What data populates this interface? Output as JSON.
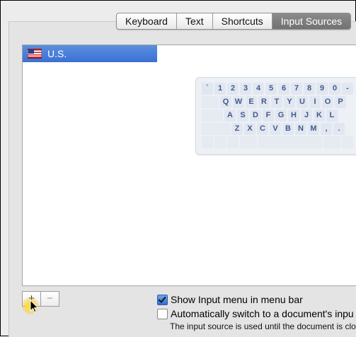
{
  "tabs": [
    {
      "label": "Keyboard",
      "active": false
    },
    {
      "label": "Text",
      "active": false
    },
    {
      "label": "Shortcuts",
      "active": false
    },
    {
      "label": "Input Sources",
      "active": true
    }
  ],
  "sources": [
    {
      "label": "U.S.",
      "icon": "us-flag-icon",
      "selected": true
    }
  ],
  "keyboard": {
    "row1": [
      "`",
      "1",
      "2",
      "3",
      "4",
      "5",
      "6",
      "7",
      "8",
      "9",
      "0",
      "-"
    ],
    "row2": [
      "Q",
      "W",
      "E",
      "R",
      "T",
      "Y",
      "U",
      "I",
      "O",
      "P"
    ],
    "row3": [
      "A",
      "S",
      "D",
      "F",
      "G",
      "H",
      "J",
      "K",
      "L"
    ],
    "row4": [
      "Z",
      "X",
      "C",
      "V",
      "B",
      "N",
      "M",
      ",",
      "."
    ]
  },
  "buttons": {
    "add": "+",
    "remove": "−"
  },
  "options": {
    "show_menu": {
      "label": "Show Input menu in menu bar",
      "checked": true
    },
    "auto_switch": {
      "label": "Automatically switch to a document's inpu",
      "checked": false
    },
    "note": "The input source is used until the document is clo"
  },
  "colors": {
    "selection": "#3a70d3",
    "key_text": "#46598a"
  }
}
